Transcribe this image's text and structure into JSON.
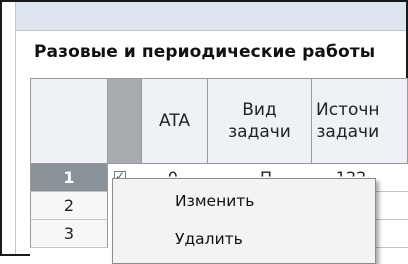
{
  "panel": {
    "title": "Разовые и периодические работы"
  },
  "grid": {
    "columns": [
      "ATA",
      "Вид задачи",
      "Источн задачи"
    ],
    "rows": [
      {
        "num": "1",
        "selected": true,
        "checked": true,
        "partial_ata": "-0",
        "partial_vid": "П",
        "partial_src": "-122"
      },
      {
        "num": "2",
        "selected": false,
        "checked": false
      },
      {
        "num": "3",
        "selected": false,
        "checked": false
      }
    ]
  },
  "context_menu": {
    "items": [
      {
        "label": "Изменить"
      },
      {
        "label": "Удалить"
      }
    ]
  },
  "colors": {
    "selected_row": "#8a929a",
    "header_bg": "#eef2f6",
    "menu_bg": "#f3f3f3"
  }
}
